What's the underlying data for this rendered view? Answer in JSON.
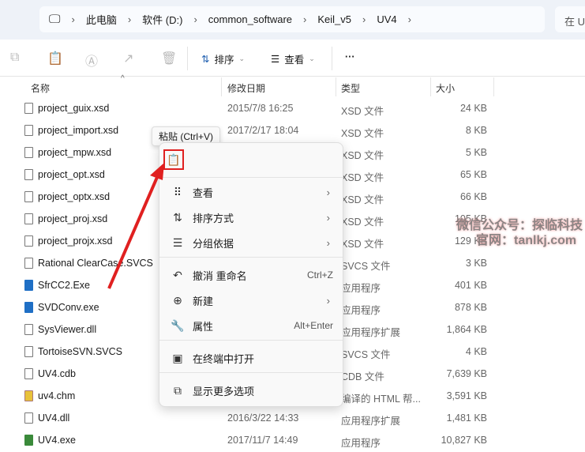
{
  "breadcrumb": [
    "此电脑",
    "软件 (D:)",
    "common_software",
    "Keil_v5",
    "UV4"
  ],
  "search_placeholder": "在 U",
  "toolbar": {
    "sort": "排序",
    "view": "查看",
    "more": "···"
  },
  "columns": {
    "name": "名称",
    "date": "修改日期",
    "type": "类型",
    "size": "大小"
  },
  "files": [
    {
      "name": "project_guix.xsd",
      "date": "2015/7/8 16:25",
      "type": "XSD 文件",
      "size": "24 KB",
      "icon": "file"
    },
    {
      "name": "project_import.xsd",
      "date": "2017/2/17 18:04",
      "type": "XSD 文件",
      "size": "8 KB",
      "icon": "file"
    },
    {
      "name": "project_mpw.xsd",
      "date": "",
      "type": "XSD 文件",
      "size": "5 KB",
      "icon": "file"
    },
    {
      "name": "project_opt.xsd",
      "date": "",
      "type": "XSD 文件",
      "size": "65 KB",
      "icon": "file"
    },
    {
      "name": "project_optx.xsd",
      "date": "",
      "type": "XSD 文件",
      "size": "66 KB",
      "icon": "file"
    },
    {
      "name": "project_proj.xsd",
      "date": "",
      "type": "XSD 文件",
      "size": "105 KB",
      "icon": "file"
    },
    {
      "name": "project_projx.xsd",
      "date": "",
      "type": "XSD 文件",
      "size": "129 KB",
      "icon": "file"
    },
    {
      "name": "Rational ClearCase.SVCS",
      "date": "",
      "type": "SVCS 文件",
      "size": "3 KB",
      "icon": "file"
    },
    {
      "name": "SfrCC2.Exe",
      "date": "",
      "type": "应用程序",
      "size": "401 KB",
      "icon": "app"
    },
    {
      "name": "SVDConv.exe",
      "date": "",
      "type": "应用程序",
      "size": "878 KB",
      "icon": "app"
    },
    {
      "name": "SysViewer.dll",
      "date": "",
      "type": "应用程序扩展",
      "size": "1,864 KB",
      "icon": "file"
    },
    {
      "name": "TortoiseSVN.SVCS",
      "date": "",
      "type": "SVCS 文件",
      "size": "4 KB",
      "icon": "file"
    },
    {
      "name": "UV4.cdb",
      "date": "",
      "type": "CDB 文件",
      "size": "7,639 KB",
      "icon": "file"
    },
    {
      "name": "uv4.chm",
      "date": "",
      "type": "编译的 HTML 帮...",
      "size": "3,591 KB",
      "icon": "chm"
    },
    {
      "name": "UV4.dll",
      "date": "2016/3/22 14:33",
      "type": "应用程序扩展",
      "size": "1,481 KB",
      "icon": "file"
    },
    {
      "name": "UV4.exe",
      "date": "2017/11/7 14:49",
      "type": "应用程序",
      "size": "10,827 KB",
      "icon": "exe"
    }
  ],
  "tooltip": "粘贴 (Ctrl+V)",
  "menu": [
    {
      "label": "查看",
      "icon": "⠿",
      "shortcut": "",
      "sub": true
    },
    {
      "label": "排序方式",
      "icon": "⇅",
      "shortcut": "",
      "sub": true
    },
    {
      "label": "分组依据",
      "icon": "☰",
      "shortcut": "",
      "sub": true
    },
    {
      "label": "撤消 重命名",
      "icon": "↶",
      "shortcut": "Ctrl+Z",
      "sub": false
    },
    {
      "label": "新建",
      "icon": "⊕",
      "shortcut": "",
      "sub": true
    },
    {
      "label": "属性",
      "icon": "🔧",
      "shortcut": "Alt+Enter",
      "sub": false
    },
    {
      "label": "在终端中打开",
      "icon": "▣",
      "shortcut": "",
      "sub": false
    },
    {
      "label": "显示更多选项",
      "icon": "⧉",
      "shortcut": "",
      "sub": false
    }
  ],
  "watermark": [
    "微信公众号：探临科技",
    "官网：tanlkj.com"
  ],
  "arrow_color": "#e02020"
}
